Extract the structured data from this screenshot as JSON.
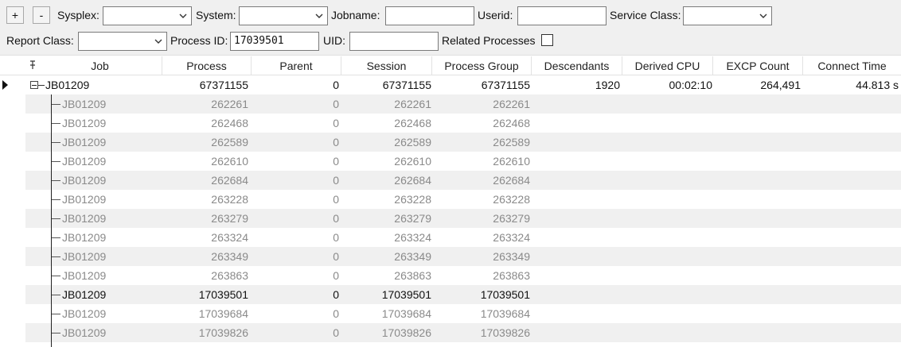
{
  "toolbar": {
    "add_label": "+",
    "remove_label": "-",
    "sysplex_label": "Sysplex:",
    "system_label": "System:",
    "jobname_label": "Jobname:",
    "userid_label": "Userid:",
    "service_class_label": "Service Class:",
    "report_class_label": "Report Class:",
    "process_id_label": "Process ID:",
    "process_id_value": "17039501",
    "uid_label": "UID:",
    "related_label": "Related Processes"
  },
  "columns": {
    "job": "Job",
    "process": "Process",
    "parent": "Parent",
    "session": "Session",
    "group": "Process Group",
    "descendants": "Descendants",
    "derived_cpu": "Derived CPU",
    "excp": "EXCP Count",
    "connect": "Connect Time"
  },
  "root": {
    "job": "JB01209",
    "process": "67371155",
    "parent": "0",
    "session": "67371155",
    "group": "67371155",
    "descendants": "1920",
    "derived_cpu": "00:02:10",
    "excp": "264,491",
    "connect": "44.813 s"
  },
  "children": [
    {
      "job": "JB01209",
      "process": "262261",
      "parent": "0",
      "session": "262261",
      "group": "262261"
    },
    {
      "job": "JB01209",
      "process": "262468",
      "parent": "0",
      "session": "262468",
      "group": "262468"
    },
    {
      "job": "JB01209",
      "process": "262589",
      "parent": "0",
      "session": "262589",
      "group": "262589"
    },
    {
      "job": "JB01209",
      "process": "262610",
      "parent": "0",
      "session": "262610",
      "group": "262610"
    },
    {
      "job": "JB01209",
      "process": "262684",
      "parent": "0",
      "session": "262684",
      "group": "262684"
    },
    {
      "job": "JB01209",
      "process": "263228",
      "parent": "0",
      "session": "263228",
      "group": "263228"
    },
    {
      "job": "JB01209",
      "process": "263279",
      "parent": "0",
      "session": "263279",
      "group": "263279"
    },
    {
      "job": "JB01209",
      "process": "263324",
      "parent": "0",
      "session": "263324",
      "group": "263324"
    },
    {
      "job": "JB01209",
      "process": "263349",
      "parent": "0",
      "session": "263349",
      "group": "263349"
    },
    {
      "job": "JB01209",
      "process": "263863",
      "parent": "0",
      "session": "263863",
      "group": "263863"
    },
    {
      "job": "JB01209",
      "process": "17039501",
      "parent": "0",
      "session": "17039501",
      "group": "17039501"
    },
    {
      "job": "JB01209",
      "process": "17039684",
      "parent": "0",
      "session": "17039684",
      "group": "17039684"
    },
    {
      "job": "JB01209",
      "process": "17039826",
      "parent": "0",
      "session": "17039826",
      "group": "17039826"
    }
  ],
  "selected_process": "17039501",
  "colors": {
    "toolbar_bg": "#f0f0f0",
    "alt_row": "#f0f0f0",
    "child_text": "#8a8a8a",
    "selected_text": "#111111"
  }
}
